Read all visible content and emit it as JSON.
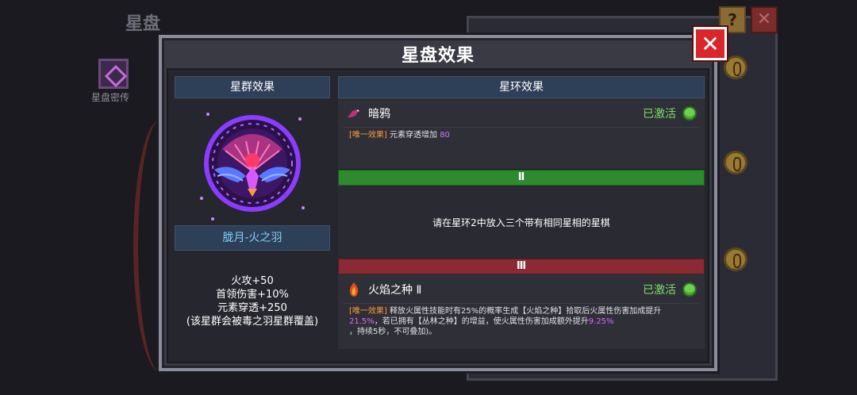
{
  "background": {
    "title": "星盘",
    "side_item_label": "星盘密传"
  },
  "modal": {
    "title": "星盘效果"
  },
  "cluster": {
    "header": "星群效果",
    "name": "胧月-火之羽",
    "stats": [
      "火攻+50",
      "首领伤害+10%",
      "元素穿透+250",
      "(该星群会被毒之羽星群覆盖)"
    ]
  },
  "ring": {
    "header": "星环效果",
    "effects": [
      {
        "name": "暗鸦",
        "icon": "crow-icon",
        "status": "已激活",
        "desc_tag": "[唯一效果]",
        "desc_text": "元素穿透增加",
        "desc_value": "80"
      },
      {
        "name": "火焰之种 Ⅱ",
        "icon": "flame-seed-icon",
        "status": "已激活",
        "desc_tag": "[唯一效果]",
        "desc_part1": "释放火属性技能时有25%的概率生成【火焰之种】拾取后火属性伤害加成提升",
        "desc_value1": "21.5%",
        "desc_part2": "，若已拥有【丛林之种】的增益，使火属性伤害加成额外提升",
        "desc_value2": "9.25%",
        "desc_part3": "，持续5秒，不可叠加)。"
      }
    ],
    "tiers": [
      "Ⅱ",
      "Ⅲ"
    ],
    "empty_slot_text": "请在星环2中放入三个带有相同星相的星棋"
  },
  "colors": {
    "accent_green": "#7ee06b",
    "close_red": "#d8262a",
    "tag_orange": "#ff9a3c",
    "highlight_purple": "#d86bff"
  }
}
